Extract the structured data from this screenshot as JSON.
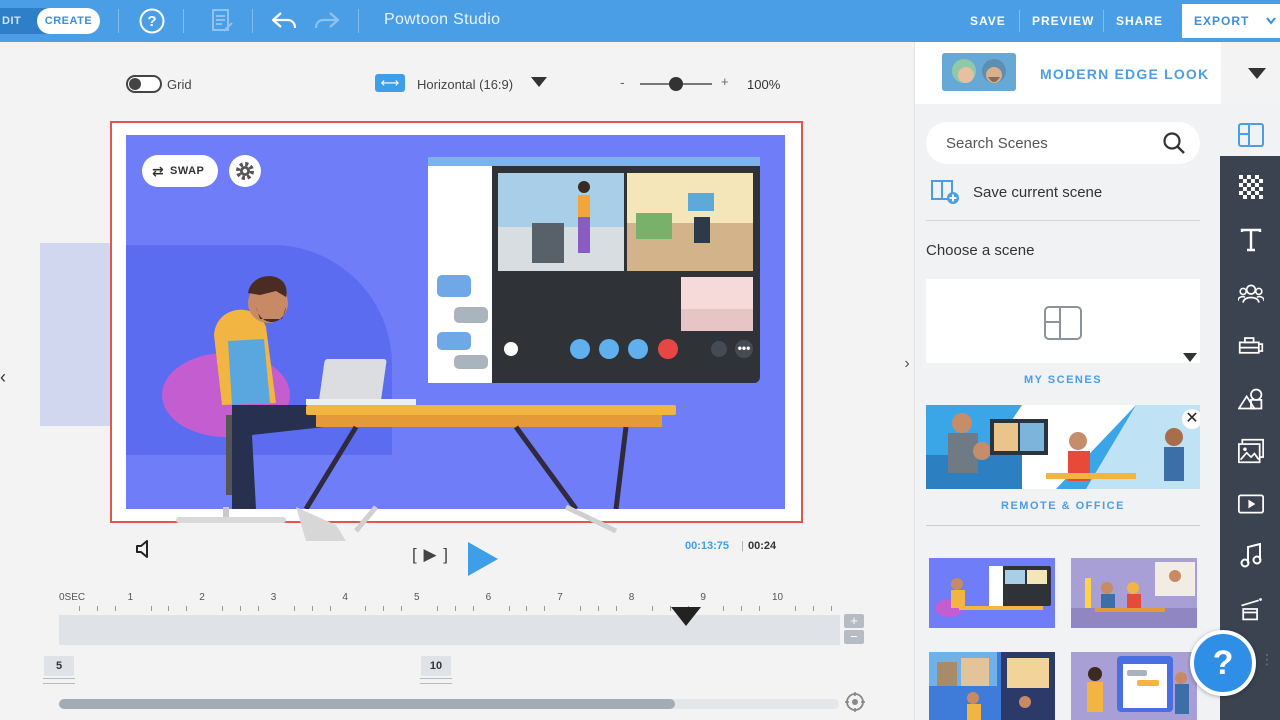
{
  "topbar": {
    "mode_edit": "DIT",
    "mode_create": "CREATE",
    "app_title": "Powtoon Studio",
    "save": "SAVE",
    "preview": "PREVIEW",
    "share": "SHARE",
    "export": "EXPORT"
  },
  "toolbar": {
    "grid_label": "Grid",
    "grid_on": false,
    "orientation_label": "Horizontal (16:9)",
    "zoom_minus": "-",
    "zoom_plus": "+",
    "zoom_label": "100%"
  },
  "stage": {
    "swap_label": "SWAP",
    "nav_left": "‹",
    "nav_right": "›"
  },
  "playback": {
    "frame_step": "[ ▶ ]",
    "current_time": "00:13:75",
    "separator": "|",
    "total_time": "00:24"
  },
  "timeline": {
    "ruler_labels": [
      "0SEC",
      "1",
      "2",
      "3",
      "4",
      "5",
      "6",
      "7",
      "8",
      "9",
      "10"
    ],
    "zoom_in": "+",
    "zoom_out": "−",
    "marker_1": "5",
    "marker_2": "10",
    "scroll_position": 0.79
  },
  "panel": {
    "style_name": "MODERN EDGE LOOK",
    "search_placeholder": "Search Scenes",
    "save_scene_label": "Save current scene",
    "choose_label": "Choose a scene",
    "my_scenes_label": "MY SCENES",
    "remote_office_label": "REMOTE & OFFICE",
    "close_badge": "✕"
  },
  "help": {
    "label": "?",
    "dots": "⋮"
  },
  "rail_icons": [
    "layout-icon",
    "background-icon",
    "text-icon",
    "characters-icon",
    "props-icon",
    "shapes-icon",
    "media-icon",
    "video-icon",
    "music-icon",
    "specials-icon"
  ],
  "colors": {
    "accent": "#4a9ee6",
    "stage_bg": "#6f7df8",
    "selection": "#e0584c",
    "rail": "#3b4350"
  }
}
